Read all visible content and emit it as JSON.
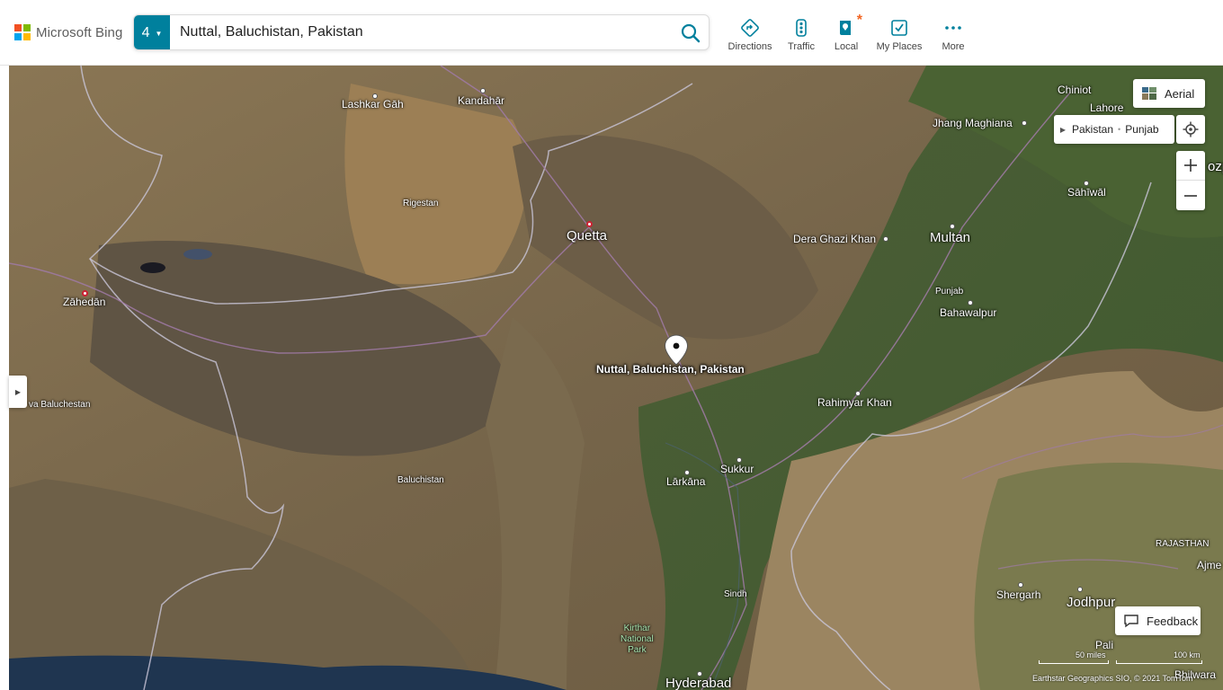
{
  "brand": {
    "name": "Microsoft Bing",
    "colors": [
      "#f25022",
      "#7fba00",
      "#00a4ef",
      "#ffb900"
    ]
  },
  "search": {
    "result_count": "4",
    "query": "Nuttal, Baluchistan, Pakistan",
    "search_icon": "search-icon"
  },
  "nav": {
    "directions": "Directions",
    "traffic": "Traffic",
    "local": "Local",
    "my_places": "My Places",
    "more": "More"
  },
  "map": {
    "pin_label": "Nuttal, Baluchistan, Pakistan",
    "places": {
      "lashkar_gah": "Lashkar Gāh",
      "kandahar": "Kandahār",
      "rigestan": "Rigestan",
      "quetta": "Quetta",
      "zahedan": "Zāhedān",
      "sistan": "va Baluchestan",
      "baluchistan": "Baluchistan",
      "chiniot": "Chiniot",
      "lahore": "Lahore",
      "jhang": "Jhang Maghiana",
      "sahiwal": "Sāhīwāl",
      "dera_ghazi_khan": "Dera Ghazi Khan",
      "multan": "Multan",
      "punjab": "Punjab",
      "bahawalpur": "Bahawalpur",
      "rahimyar_khan": "Rahimyar Khan",
      "sukkur": "Sukkur",
      "larkana": "Lārkāna",
      "sindh": "Sindh",
      "kirthar": "Kirthar\nNational\nPark",
      "hyderabad": "Hyderabad",
      "rajasthan": "RAJASTHAN",
      "shergarh": "Shergarh",
      "jodhpur": "Jodhpur",
      "ajmer": "Ajme",
      "pali": "Pali",
      "bhilwara": "Bhilwara",
      "ozp": "ozp"
    }
  },
  "controls": {
    "aerial": "Aerial",
    "breadcrumb_country": "Pakistan",
    "breadcrumb_region": "Punjab",
    "feedback": "Feedback"
  },
  "scale": {
    "miles": "50 miles",
    "km": "100 km"
  },
  "attribution": "Earthstar Geographics SIO, © 2021 TomTom"
}
